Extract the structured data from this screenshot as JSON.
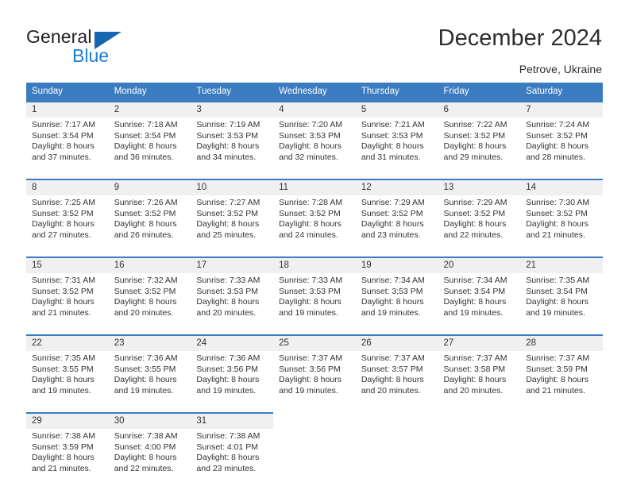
{
  "brand": {
    "name_part1": "General",
    "name_part2": "Blue",
    "accent_color": "#1a7fd4",
    "triangle_color": "#1566b0"
  },
  "header": {
    "title": "December 2024",
    "subtitle": "Petrove, Ukraine"
  },
  "calendar": {
    "header_bg": "#3b7cc0",
    "daynum_bg": "#f0f0f0",
    "weekdays": [
      "Sunday",
      "Monday",
      "Tuesday",
      "Wednesday",
      "Thursday",
      "Friday",
      "Saturday"
    ],
    "weeks": [
      {
        "days": [
          {
            "num": "1",
            "sunrise": "Sunrise: 7:17 AM",
            "sunset": "Sunset: 3:54 PM",
            "daylight1": "Daylight: 8 hours",
            "daylight2": "and 37 minutes."
          },
          {
            "num": "2",
            "sunrise": "Sunrise: 7:18 AM",
            "sunset": "Sunset: 3:54 PM",
            "daylight1": "Daylight: 8 hours",
            "daylight2": "and 36 minutes."
          },
          {
            "num": "3",
            "sunrise": "Sunrise: 7:19 AM",
            "sunset": "Sunset: 3:53 PM",
            "daylight1": "Daylight: 8 hours",
            "daylight2": "and 34 minutes."
          },
          {
            "num": "4",
            "sunrise": "Sunrise: 7:20 AM",
            "sunset": "Sunset: 3:53 PM",
            "daylight1": "Daylight: 8 hours",
            "daylight2": "and 32 minutes."
          },
          {
            "num": "5",
            "sunrise": "Sunrise: 7:21 AM",
            "sunset": "Sunset: 3:53 PM",
            "daylight1": "Daylight: 8 hours",
            "daylight2": "and 31 minutes."
          },
          {
            "num": "6",
            "sunrise": "Sunrise: 7:22 AM",
            "sunset": "Sunset: 3:52 PM",
            "daylight1": "Daylight: 8 hours",
            "daylight2": "and 29 minutes."
          },
          {
            "num": "7",
            "sunrise": "Sunrise: 7:24 AM",
            "sunset": "Sunset: 3:52 PM",
            "daylight1": "Daylight: 8 hours",
            "daylight2": "and 28 minutes."
          }
        ]
      },
      {
        "days": [
          {
            "num": "8",
            "sunrise": "Sunrise: 7:25 AM",
            "sunset": "Sunset: 3:52 PM",
            "daylight1": "Daylight: 8 hours",
            "daylight2": "and 27 minutes."
          },
          {
            "num": "9",
            "sunrise": "Sunrise: 7:26 AM",
            "sunset": "Sunset: 3:52 PM",
            "daylight1": "Daylight: 8 hours",
            "daylight2": "and 26 minutes."
          },
          {
            "num": "10",
            "sunrise": "Sunrise: 7:27 AM",
            "sunset": "Sunset: 3:52 PM",
            "daylight1": "Daylight: 8 hours",
            "daylight2": "and 25 minutes."
          },
          {
            "num": "11",
            "sunrise": "Sunrise: 7:28 AM",
            "sunset": "Sunset: 3:52 PM",
            "daylight1": "Daylight: 8 hours",
            "daylight2": "and 24 minutes."
          },
          {
            "num": "12",
            "sunrise": "Sunrise: 7:29 AM",
            "sunset": "Sunset: 3:52 PM",
            "daylight1": "Daylight: 8 hours",
            "daylight2": "and 23 minutes."
          },
          {
            "num": "13",
            "sunrise": "Sunrise: 7:29 AM",
            "sunset": "Sunset: 3:52 PM",
            "daylight1": "Daylight: 8 hours",
            "daylight2": "and 22 minutes."
          },
          {
            "num": "14",
            "sunrise": "Sunrise: 7:30 AM",
            "sunset": "Sunset: 3:52 PM",
            "daylight1": "Daylight: 8 hours",
            "daylight2": "and 21 minutes."
          }
        ]
      },
      {
        "days": [
          {
            "num": "15",
            "sunrise": "Sunrise: 7:31 AM",
            "sunset": "Sunset: 3:52 PM",
            "daylight1": "Daylight: 8 hours",
            "daylight2": "and 21 minutes."
          },
          {
            "num": "16",
            "sunrise": "Sunrise: 7:32 AM",
            "sunset": "Sunset: 3:52 PM",
            "daylight1": "Daylight: 8 hours",
            "daylight2": "and 20 minutes."
          },
          {
            "num": "17",
            "sunrise": "Sunrise: 7:33 AM",
            "sunset": "Sunset: 3:53 PM",
            "daylight1": "Daylight: 8 hours",
            "daylight2": "and 20 minutes."
          },
          {
            "num": "18",
            "sunrise": "Sunrise: 7:33 AM",
            "sunset": "Sunset: 3:53 PM",
            "daylight1": "Daylight: 8 hours",
            "daylight2": "and 19 minutes."
          },
          {
            "num": "19",
            "sunrise": "Sunrise: 7:34 AM",
            "sunset": "Sunset: 3:53 PM",
            "daylight1": "Daylight: 8 hours",
            "daylight2": "and 19 minutes."
          },
          {
            "num": "20",
            "sunrise": "Sunrise: 7:34 AM",
            "sunset": "Sunset: 3:54 PM",
            "daylight1": "Daylight: 8 hours",
            "daylight2": "and 19 minutes."
          },
          {
            "num": "21",
            "sunrise": "Sunrise: 7:35 AM",
            "sunset": "Sunset: 3:54 PM",
            "daylight1": "Daylight: 8 hours",
            "daylight2": "and 19 minutes."
          }
        ]
      },
      {
        "days": [
          {
            "num": "22",
            "sunrise": "Sunrise: 7:35 AM",
            "sunset": "Sunset: 3:55 PM",
            "daylight1": "Daylight: 8 hours",
            "daylight2": "and 19 minutes."
          },
          {
            "num": "23",
            "sunrise": "Sunrise: 7:36 AM",
            "sunset": "Sunset: 3:55 PM",
            "daylight1": "Daylight: 8 hours",
            "daylight2": "and 19 minutes."
          },
          {
            "num": "24",
            "sunrise": "Sunrise: 7:36 AM",
            "sunset": "Sunset: 3:56 PM",
            "daylight1": "Daylight: 8 hours",
            "daylight2": "and 19 minutes."
          },
          {
            "num": "25",
            "sunrise": "Sunrise: 7:37 AM",
            "sunset": "Sunset: 3:56 PM",
            "daylight1": "Daylight: 8 hours",
            "daylight2": "and 19 minutes."
          },
          {
            "num": "26",
            "sunrise": "Sunrise: 7:37 AM",
            "sunset": "Sunset: 3:57 PM",
            "daylight1": "Daylight: 8 hours",
            "daylight2": "and 20 minutes."
          },
          {
            "num": "27",
            "sunrise": "Sunrise: 7:37 AM",
            "sunset": "Sunset: 3:58 PM",
            "daylight1": "Daylight: 8 hours",
            "daylight2": "and 20 minutes."
          },
          {
            "num": "28",
            "sunrise": "Sunrise: 7:37 AM",
            "sunset": "Sunset: 3:59 PM",
            "daylight1": "Daylight: 8 hours",
            "daylight2": "and 21 minutes."
          }
        ]
      },
      {
        "days": [
          {
            "num": "29",
            "sunrise": "Sunrise: 7:38 AM",
            "sunset": "Sunset: 3:59 PM",
            "daylight1": "Daylight: 8 hours",
            "daylight2": "and 21 minutes."
          },
          {
            "num": "30",
            "sunrise": "Sunrise: 7:38 AM",
            "sunset": "Sunset: 4:00 PM",
            "daylight1": "Daylight: 8 hours",
            "daylight2": "and 22 minutes."
          },
          {
            "num": "31",
            "sunrise": "Sunrise: 7:38 AM",
            "sunset": "Sunset: 4:01 PM",
            "daylight1": "Daylight: 8 hours",
            "daylight2": "and 23 minutes."
          },
          {
            "num": "",
            "sunrise": "",
            "sunset": "",
            "daylight1": "",
            "daylight2": ""
          },
          {
            "num": "",
            "sunrise": "",
            "sunset": "",
            "daylight1": "",
            "daylight2": ""
          },
          {
            "num": "",
            "sunrise": "",
            "sunset": "",
            "daylight1": "",
            "daylight2": ""
          },
          {
            "num": "",
            "sunrise": "",
            "sunset": "",
            "daylight1": "",
            "daylight2": ""
          }
        ]
      }
    ]
  }
}
